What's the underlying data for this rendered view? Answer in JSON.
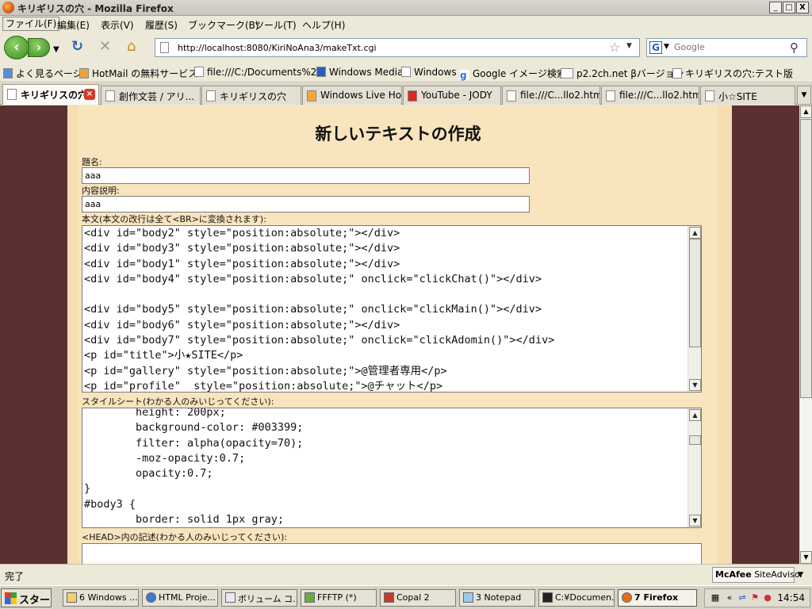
{
  "window": {
    "title": "キリギリスの穴 - Mozilla Firefox",
    "min": "_",
    "max": "□",
    "close": "X"
  },
  "menu": [
    "ファイル(F)",
    "編集(E)",
    "表示(V)",
    "履歴(S)",
    "ブックマーク(B)",
    "ツール(T)",
    "ヘルプ(H)"
  ],
  "nav": {
    "url": "http://localhost:8080/KiriNoAna3/makeTxt.cgi",
    "search_placeholder": "Google",
    "search_engine_letter": "G"
  },
  "bookmarks": [
    "よく見るページ",
    "HotMail の無料サービス",
    "file:///C:/Documents%2...",
    "Windows Media",
    "Windows",
    "Google イメージ検索",
    "p2.2ch.net βバージョン",
    "キリギリスの穴:テスト版"
  ],
  "tabs": [
    "キリギリスの穴",
    "創作文芸 / アリ...",
    "キリギリスの穴",
    "Windows Live Ho...",
    "YouTube - JODY",
    "file:///C...llo2.html",
    "file:///C...llo2.html",
    "小☆SITE"
  ],
  "page": {
    "heading": "新しいテキストの作成",
    "title_label": "題名:",
    "title_value": "aaa",
    "desc_label": "内容説明:",
    "desc_value": "aaa",
    "body_label": "本文(本文の改行は全て<BR>に変換されます):",
    "body_lines": [
      "<div id=\"body2\" style=\"position:absolute;\"></div>",
      "<div id=\"body3\" style=\"position:absolute;\"></div>",
      "<div id=\"body1\" style=\"position:absolute;\"></div>",
      "<div id=\"body4\" style=\"position:absolute;\" onclick=\"clickChat()\"></div>",
      "",
      "<div id=\"body5\" style=\"position:absolute;\" onclick=\"clickMain()\"></div>",
      "<div id=\"body6\" style=\"position:absolute;\"></div>",
      "<div id=\"body7\" style=\"position:absolute;\" onclick=\"clickAdomin()\"></div>",
      "<p id=\"title\">小★SITE</p>",
      "<p id=\"gallery\" style=\"position:absolute;\">@管理者専用</p>",
      "<p id=\"profile\"  style=\"position:absolute;\">@チャット</p>"
    ],
    "style_label": "スタイルシート(わかる人のみいじってください):",
    "style_lines": [
      "        height: 200px;",
      "        background-color: #003399;",
      "        filter: alpha(opacity=70);",
      "        -moz-opacity:0.7;",
      "        opacity:0.7;",
      "}",
      "#body3 {",
      "        border: solid 1px gray;"
    ],
    "head_label": "<HEAD>内の記述(わかる人のみいじってください):"
  },
  "status": {
    "text": "完了",
    "mcafee": "McAfee",
    "siteadvisor": "SiteAdvisor"
  },
  "taskbar": {
    "start": "スタート",
    "items": [
      "6 Windows ...",
      "HTML Proje...",
      "ボリューム コ...",
      "FFFTP (*)",
      "Copal 2",
      "3 Notepad",
      "C:¥Documen...",
      "7 Firefox"
    ],
    "clock": "14:54"
  }
}
